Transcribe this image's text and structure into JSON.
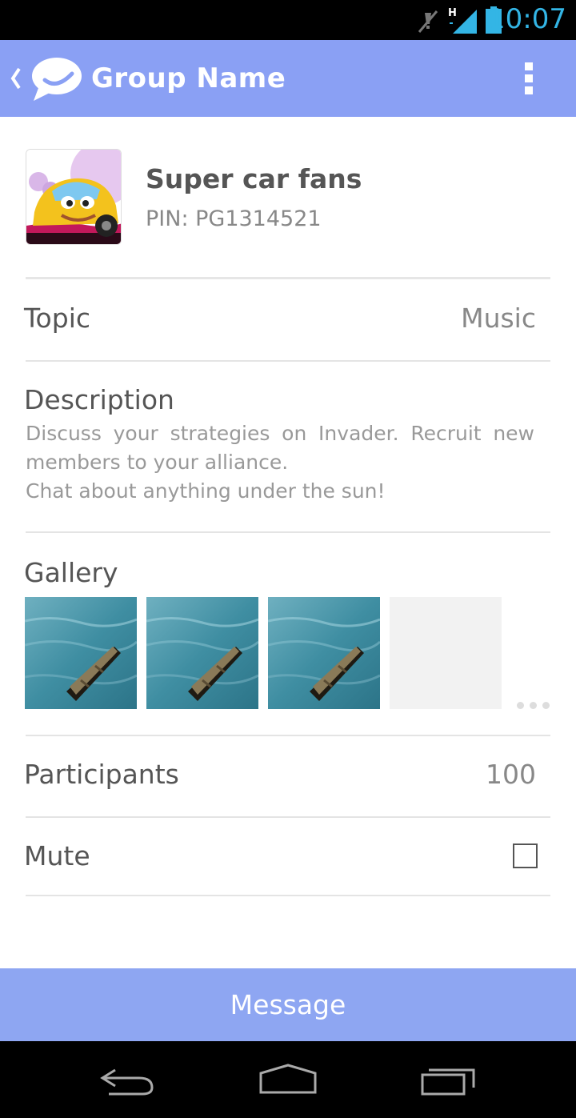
{
  "status_bar": {
    "time": "10:07",
    "icons": [
      "mute-icon",
      "signal-icon",
      "battery-icon"
    ],
    "network_label": "H"
  },
  "action_bar": {
    "title": "Group Name",
    "background": "#8aa0f4"
  },
  "group": {
    "name": "Super car fans",
    "pin": "PIN: PG1314521"
  },
  "topic": {
    "label": "Topic",
    "value": "Music"
  },
  "description": {
    "label": "Description",
    "lines": [
      "Discuss your strategies on Invader. Recruit new members to your alliance.",
      "Chat about anything under the sun!"
    ]
  },
  "gallery": {
    "label": "Gallery",
    "items": [
      "boat-photo",
      "boat-photo",
      "boat-photo",
      "empty-slot"
    ]
  },
  "participants": {
    "label": "Participants",
    "value": "100"
  },
  "mute": {
    "label": "Mute",
    "checked": false
  },
  "message_button": {
    "label": "Message",
    "background": "#8ea6f2"
  },
  "colors": {
    "accent": "#8aa0f4",
    "status_time": "#33b5e5"
  }
}
